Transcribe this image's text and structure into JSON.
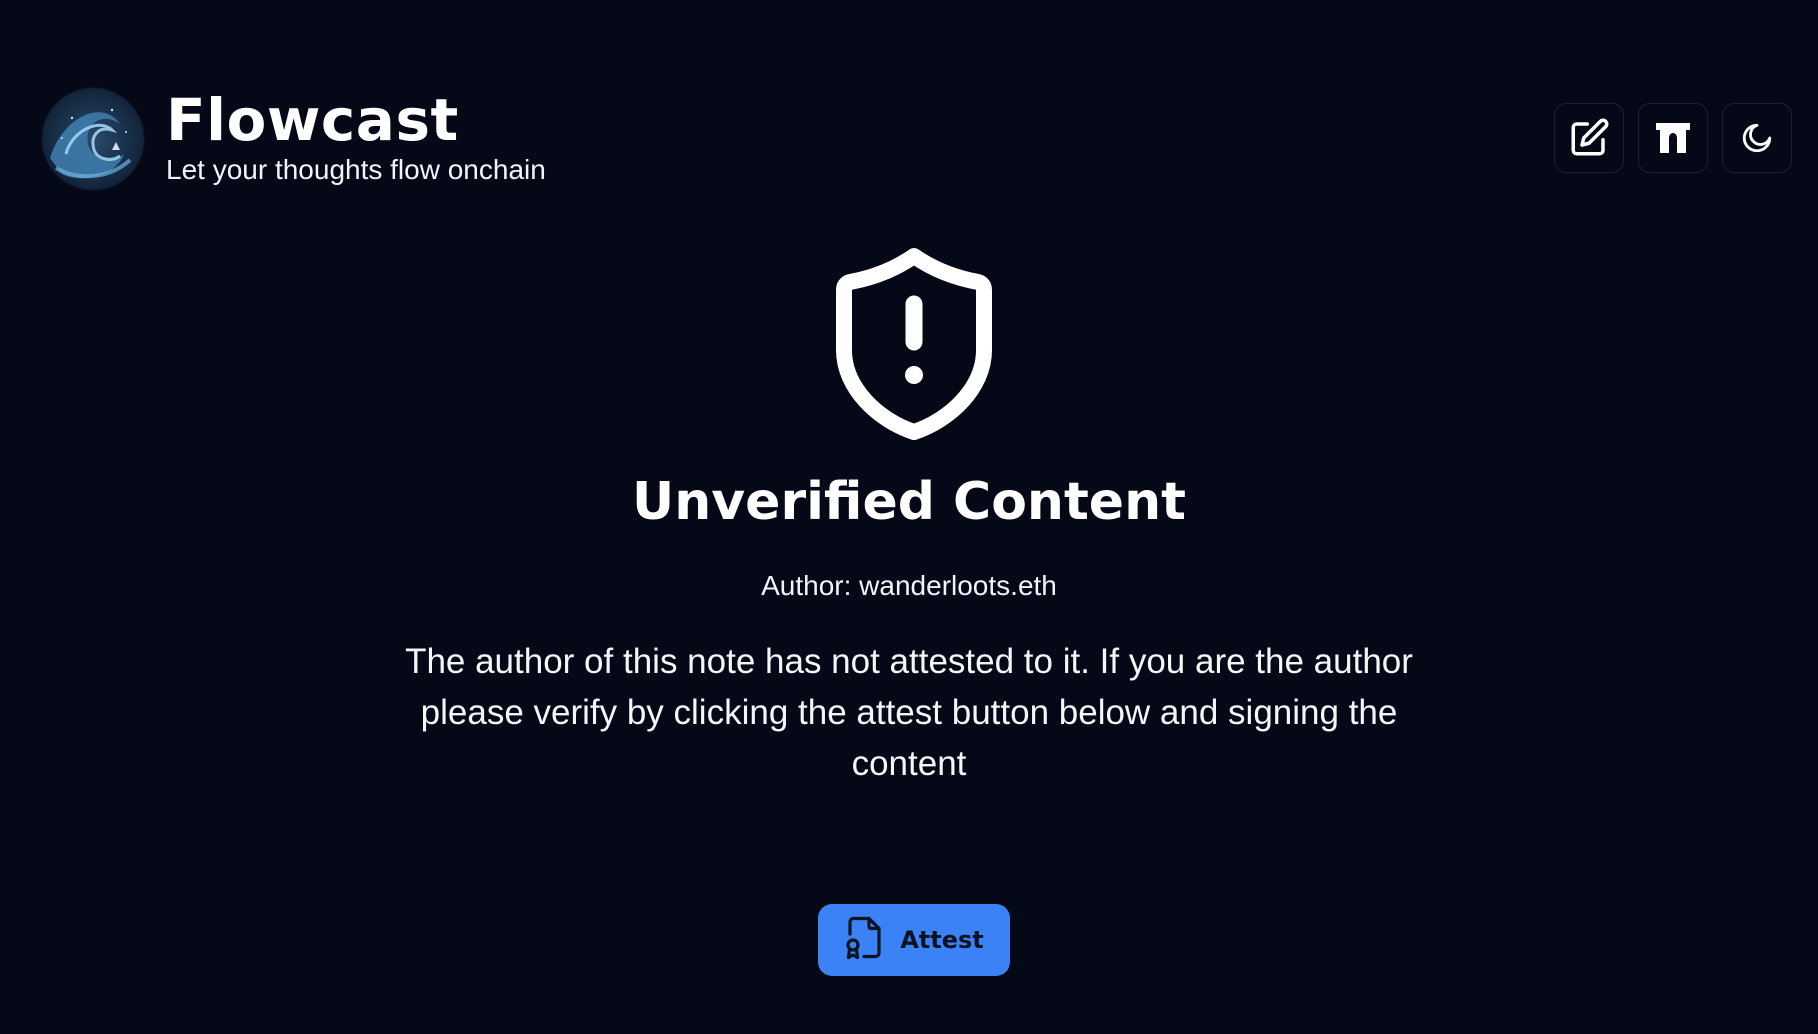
{
  "header": {
    "title": "Flowcast",
    "tagline": "Let your thoughts flow onchain",
    "logo_icon": "wave-logo-icon",
    "toolbar": [
      {
        "icon": "edit-icon",
        "name": "edit-button"
      },
      {
        "icon": "gateway-icon",
        "name": "gateway-button"
      },
      {
        "icon": "moon-icon",
        "name": "theme-toggle-button"
      }
    ]
  },
  "main": {
    "icon": "shield-alert-icon",
    "heading": "Unverified Content",
    "author": "Author: wanderloots.eth",
    "message": "The author of this note has not attested to it. If you are the author please verify by clicking the attest button below and signing the content",
    "attest_label": "Attest",
    "attest_icon": "file-certificate-icon"
  },
  "colors": {
    "background": "#040817",
    "text": "#ffffff",
    "accent": "#3b82f6",
    "button_border": "#1d2233"
  }
}
